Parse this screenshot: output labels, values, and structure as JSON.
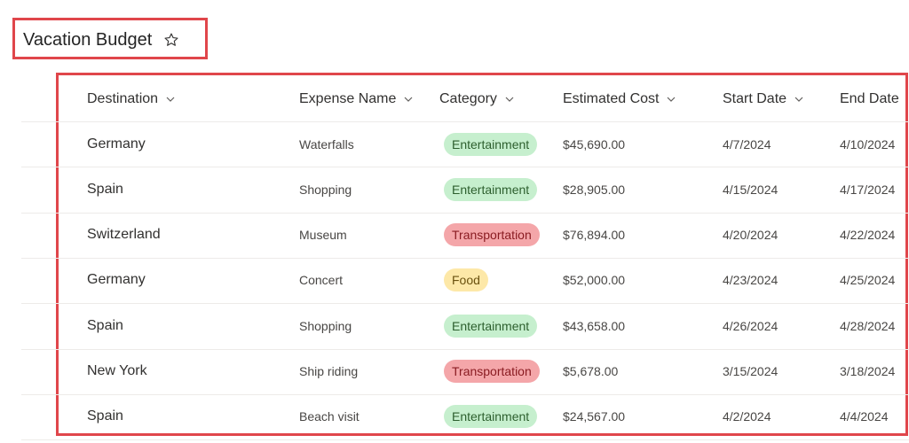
{
  "page": {
    "title": "Vacation Budget",
    "favorite_icon": "star-outline-icon"
  },
  "colors": {
    "highlight_border": "#e0464b",
    "Entertainment": {
      "bg": "#c6efce",
      "fg": "#2d5f2e"
    },
    "Transportation": {
      "bg": "#f4a6a9",
      "fg": "#8a1c22"
    },
    "Food": {
      "bg": "#fde8a8",
      "fg": "#6b5210"
    }
  },
  "table": {
    "columns": [
      {
        "key": "destination",
        "label": "Destination"
      },
      {
        "key": "expense",
        "label": "Expense Name"
      },
      {
        "key": "category",
        "label": "Category"
      },
      {
        "key": "cost",
        "label": "Estimated Cost"
      },
      {
        "key": "start",
        "label": "Start Date"
      },
      {
        "key": "end",
        "label": "End Date"
      }
    ],
    "rows": [
      {
        "destination": "Germany",
        "expense": "Waterfalls",
        "category": "Entertainment",
        "cost": "$45,690.00",
        "start": "4/7/2024",
        "end": "4/10/2024"
      },
      {
        "destination": "Spain",
        "expense": "Shopping",
        "category": "Entertainment",
        "cost": "$28,905.00",
        "start": "4/15/2024",
        "end": "4/17/2024"
      },
      {
        "destination": "Switzerland",
        "expense": "Museum",
        "category": "Transportation",
        "cost": "$76,894.00",
        "start": "4/20/2024",
        "end": "4/22/2024"
      },
      {
        "destination": "Germany",
        "expense": "Concert",
        "category": "Food",
        "cost": "$52,000.00",
        "start": "4/23/2024",
        "end": "4/25/2024"
      },
      {
        "destination": "Spain",
        "expense": "Shopping",
        "category": "Entertainment",
        "cost": "$43,658.00",
        "start": "4/26/2024",
        "end": "4/28/2024"
      },
      {
        "destination": "New York",
        "expense": "Ship riding",
        "category": "Transportation",
        "cost": "$5,678.00",
        "start": "3/15/2024",
        "end": "3/18/2024"
      },
      {
        "destination": "Spain",
        "expense": "Beach visit",
        "category": "Entertainment",
        "cost": "$24,567.00",
        "start": "4/2/2024",
        "end": "4/4/2024"
      }
    ]
  }
}
